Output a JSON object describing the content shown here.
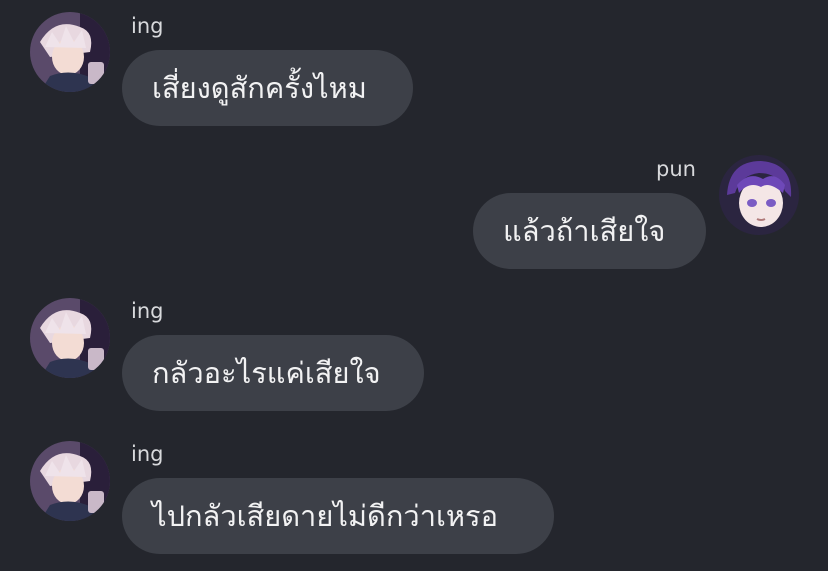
{
  "messages": [
    {
      "sender": "ing",
      "text": "เสี่ยงดูสักครั้งไหม",
      "side": "left",
      "avatar_icon": "ing-avatar-icon"
    },
    {
      "sender": "pun",
      "text": "แล้วถ้าเสียใจ",
      "side": "right",
      "avatar_icon": "pun-avatar-icon"
    },
    {
      "sender": "ing",
      "text": "กลัวอะไรแค่เสียใจ",
      "side": "left",
      "avatar_icon": "ing-avatar-icon"
    },
    {
      "sender": "ing",
      "text": "ไปกลัวเสียดายไม่ดีกว่าเหรอ",
      "side": "left",
      "avatar_icon": "ing-avatar-icon"
    }
  ],
  "colors": {
    "background": "#24262d",
    "bubble": "#3d4048",
    "bubble_text": "#f2f2f3",
    "name_text": "#d8d9dc"
  }
}
